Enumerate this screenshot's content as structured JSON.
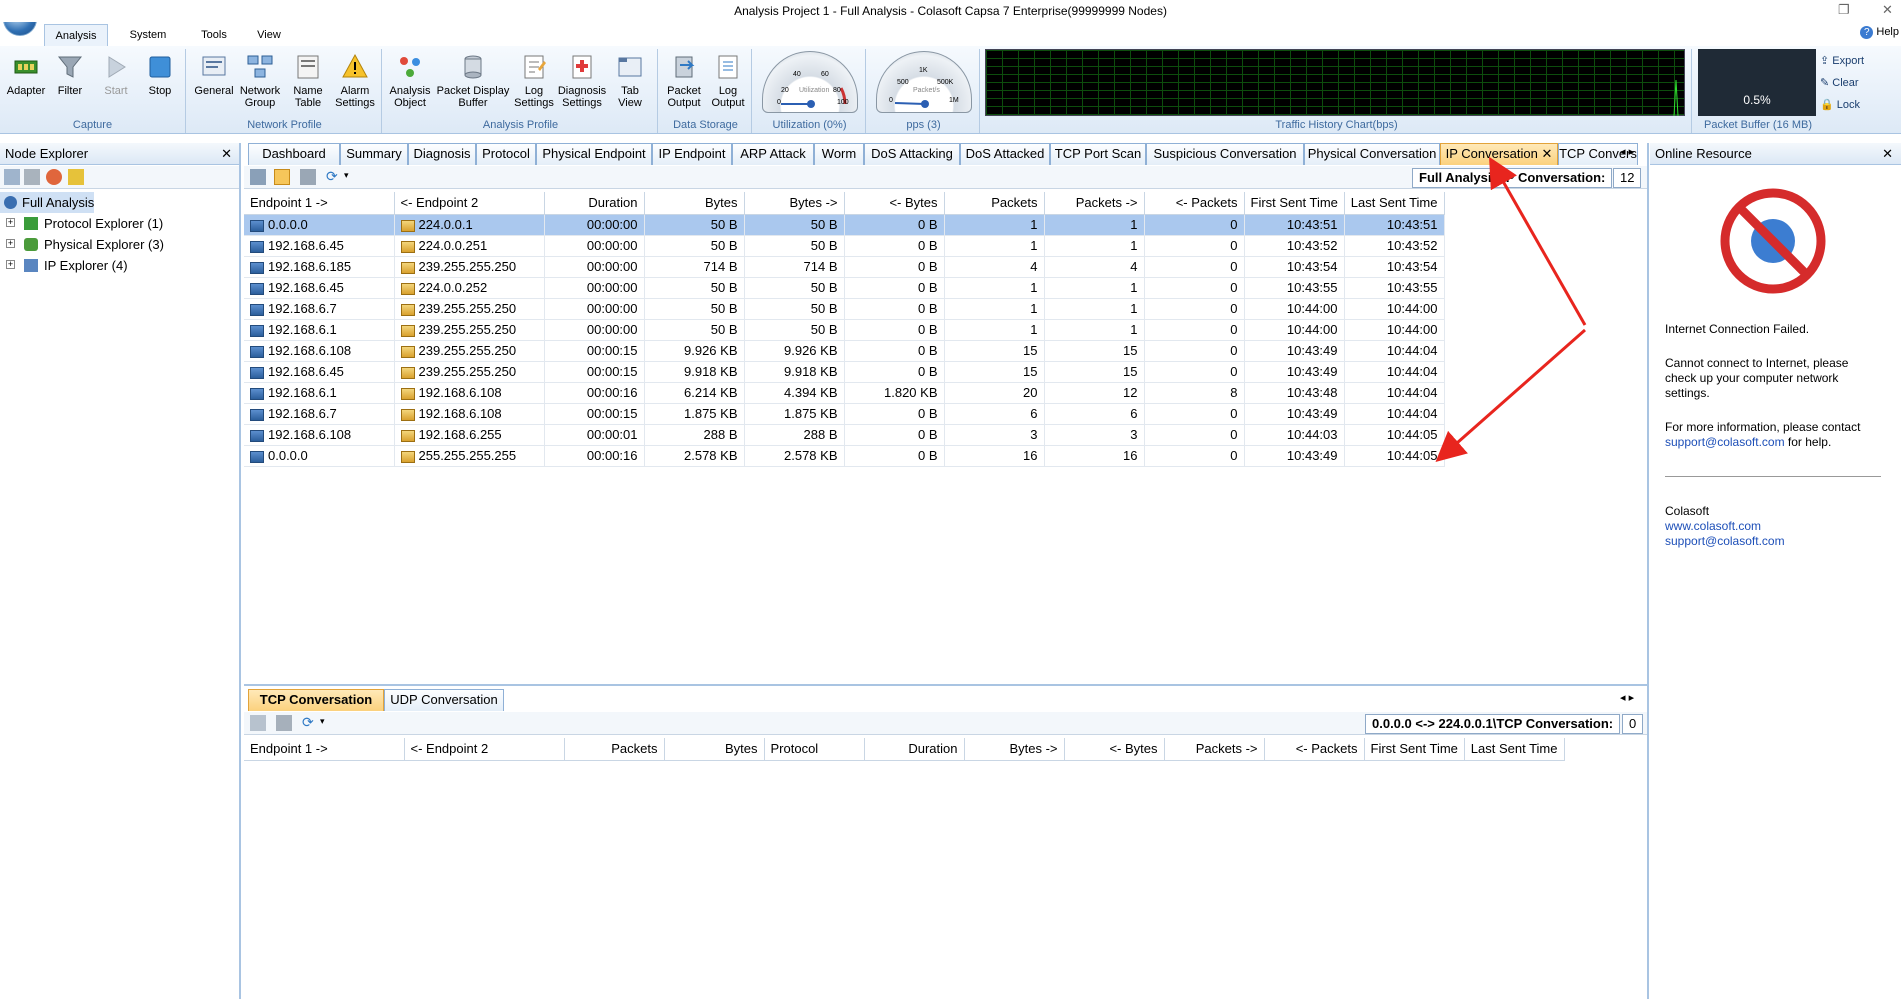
{
  "window": {
    "title": "Analysis Project 1 - Full Analysis - Colasoft Capsa 7 Enterprise(99999999 Nodes)"
  },
  "menu": {
    "tabs": [
      "Analysis",
      "System",
      "Tools",
      "View"
    ],
    "help": "Help"
  },
  "ribbon": {
    "capture": {
      "label": "Capture",
      "buttons": [
        "Adapter",
        "Filter",
        "Start",
        "Stop"
      ]
    },
    "network_profile": {
      "label": "Network Profile",
      "buttons": [
        "General",
        "Network\nGroup",
        "Name\nTable",
        "Alarm\nSettings"
      ]
    },
    "analysis_profile": {
      "label": "Analysis Profile",
      "buttons": [
        "Analysis\nObject",
        "Packet Display\nBuffer",
        "Log\nSettings",
        "Diagnosis\nSettings",
        "Tab\nView"
      ]
    },
    "data_storage": {
      "label": "Data Storage",
      "buttons": [
        "Packet\nOutput",
        "Log\nOutput"
      ]
    },
    "utilization": {
      "label": "Utilization (0%)",
      "ticks": [
        "20",
        "40",
        "60",
        "80",
        "100",
        "0"
      ],
      "caption": "Utilization",
      "level": 0
    },
    "pps": {
      "label": "pps (3)",
      "ticks": [
        "500",
        "1K",
        "500K",
        "1M",
        "0"
      ],
      "caption": "Packet/s",
      "value": 3
    },
    "traffic": {
      "label": "Traffic History Chart(bps)"
    },
    "buffer": {
      "label": "Packet Buffer (16 MB)",
      "value": "0.5%",
      "side": [
        "Export",
        "Clear",
        "Lock"
      ]
    }
  },
  "node_explorer": {
    "title": "Node Explorer",
    "items": [
      {
        "label": "Full Analysis"
      },
      {
        "label": "Protocol Explorer (1)"
      },
      {
        "label": "Physical Explorer (3)"
      },
      {
        "label": "IP Explorer (4)"
      }
    ]
  },
  "tabs": [
    "Dashboard",
    "Summary",
    "Diagnosis",
    "Protocol",
    "Physical Endpoint",
    "IP Endpoint",
    "ARP Attack",
    "Worm",
    "DoS Attacking",
    "DoS Attacked",
    "TCP Port Scan",
    "Suspicious Conversation",
    "Physical Conversation",
    "IP Conversation",
    "TCP Convers"
  ],
  "ip_conv": {
    "summary": "Full Analysis\\IP Conversation:",
    "count": "12",
    "columns": [
      "Endpoint 1 ->",
      "<- Endpoint 2",
      "Duration",
      "Bytes",
      "Bytes ->",
      "<- Bytes",
      "Packets",
      "Packets ->",
      "<- Packets",
      "First Sent Time",
      "Last Sent Time"
    ],
    "rows": [
      [
        "0.0.0.0",
        "224.0.0.1",
        "00:00:00",
        "50  B",
        "50  B",
        "0  B",
        "1",
        "1",
        "0",
        "10:43:51",
        "10:43:51"
      ],
      [
        "192.168.6.45",
        "224.0.0.251",
        "00:00:00",
        "50  B",
        "50  B",
        "0  B",
        "1",
        "1",
        "0",
        "10:43:52",
        "10:43:52"
      ],
      [
        "192.168.6.185",
        "239.255.255.250",
        "00:00:00",
        "714  B",
        "714  B",
        "0  B",
        "4",
        "4",
        "0",
        "10:43:54",
        "10:43:54"
      ],
      [
        "192.168.6.45",
        "224.0.0.252",
        "00:00:00",
        "50  B",
        "50  B",
        "0  B",
        "1",
        "1",
        "0",
        "10:43:55",
        "10:43:55"
      ],
      [
        "192.168.6.7",
        "239.255.255.250",
        "00:00:00",
        "50  B",
        "50  B",
        "0  B",
        "1",
        "1",
        "0",
        "10:44:00",
        "10:44:00"
      ],
      [
        "192.168.6.1",
        "239.255.255.250",
        "00:00:00",
        "50  B",
        "50  B",
        "0  B",
        "1",
        "1",
        "0",
        "10:44:00",
        "10:44:00"
      ],
      [
        "192.168.6.108",
        "239.255.255.250",
        "00:00:15",
        "9.926 KB",
        "9.926 KB",
        "0  B",
        "15",
        "15",
        "0",
        "10:43:49",
        "10:44:04"
      ],
      [
        "192.168.6.45",
        "239.255.255.250",
        "00:00:15",
        "9.918 KB",
        "9.918 KB",
        "0  B",
        "15",
        "15",
        "0",
        "10:43:49",
        "10:44:04"
      ],
      [
        "192.168.6.1",
        "192.168.6.108",
        "00:00:16",
        "6.214 KB",
        "4.394 KB",
        "1.820 KB",
        "20",
        "12",
        "8",
        "10:43:48",
        "10:44:04"
      ],
      [
        "192.168.6.7",
        "192.168.6.108",
        "00:00:15",
        "1.875 KB",
        "1.875 KB",
        "0  B",
        "6",
        "6",
        "0",
        "10:43:49",
        "10:44:04"
      ],
      [
        "192.168.6.108",
        "192.168.6.255",
        "00:00:01",
        "288  B",
        "288  B",
        "0  B",
        "3",
        "3",
        "0",
        "10:44:03",
        "10:44:05"
      ],
      [
        "0.0.0.0",
        "255.255.255.255",
        "00:00:16",
        "2.578 KB",
        "2.578 KB",
        "0  B",
        "16",
        "16",
        "0",
        "10:43:49",
        "10:44:05"
      ]
    ]
  },
  "sub_tabs": [
    "TCP Conversation",
    "UDP Conversation"
  ],
  "tcp_conv": {
    "summary": "0.0.0.0 <-> 224.0.0.1\\TCP Conversation:",
    "count": "0",
    "columns": [
      "Endpoint 1 ->",
      "<- Endpoint 2",
      "Packets",
      "Bytes",
      "Protocol",
      "Duration",
      "Bytes ->",
      "<- Bytes",
      "Packets ->",
      "<- Packets",
      "First Sent Time",
      "Last Sent Time"
    ]
  },
  "online": {
    "title": "Online Resource",
    "failed": "Internet Connection Failed.",
    "cannot": "Cannot connect to Internet, please check up your computer network settings.",
    "more": "For more information, please contact",
    "support_link": "support@colasoft.com",
    "forhelp": " for help.",
    "company": "Colasoft",
    "site": "www.colasoft.com",
    "support2": "support@colasoft.com"
  }
}
